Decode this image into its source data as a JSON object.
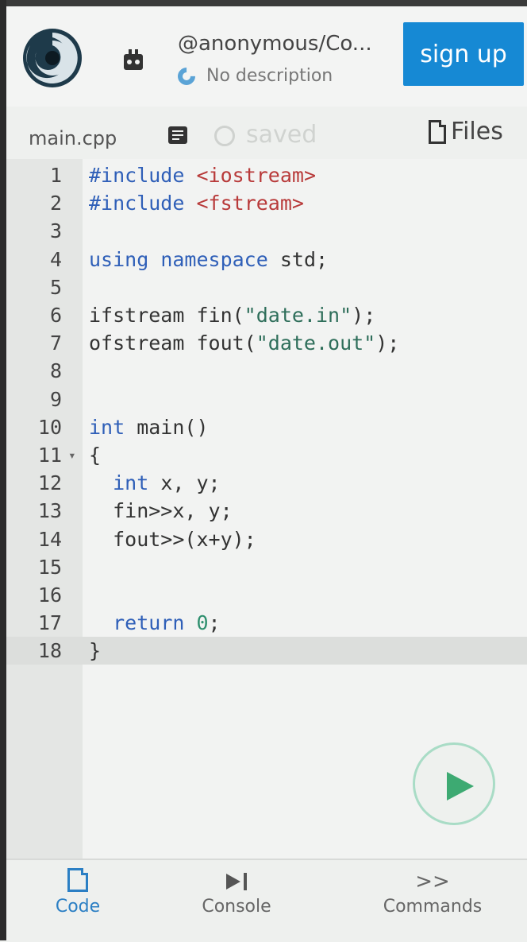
{
  "header": {
    "repl_user": "@anonymous/Co...",
    "repl_description": "No description",
    "signup_label": "sign up",
    "logo_icon": "replit-spiral-logo-icon",
    "avatar_icon": "bot-avatar-icon",
    "language_icon": "cpp-c-icon"
  },
  "filebar": {
    "filename": "main.cpp",
    "saved_label": "saved",
    "files_label": "Files",
    "doc_icon": "document-icon",
    "history_icon": "history-icon",
    "files_icon": "file-icon"
  },
  "editor": {
    "lines": [
      {
        "n": "1",
        "tokens": [
          {
            "t": "#include",
            "c": "kw"
          },
          {
            "t": " "
          },
          {
            "t": "<iostream>",
            "c": "str"
          }
        ]
      },
      {
        "n": "2",
        "tokens": [
          {
            "t": "#include",
            "c": "kw"
          },
          {
            "t": " "
          },
          {
            "t": "<fstream>",
            "c": "str"
          }
        ]
      },
      {
        "n": "3",
        "tokens": []
      },
      {
        "n": "4",
        "tokens": [
          {
            "t": "using",
            "c": "kw"
          },
          {
            "t": " "
          },
          {
            "t": "namespace",
            "c": "kw"
          },
          {
            "t": " std;"
          }
        ]
      },
      {
        "n": "5",
        "tokens": []
      },
      {
        "n": "6",
        "tokens": [
          {
            "t": "ifstream fin("
          },
          {
            "t": "\"date.in\"",
            "c": "lit"
          },
          {
            "t": ");"
          }
        ]
      },
      {
        "n": "7",
        "tokens": [
          {
            "t": "ofstream fout("
          },
          {
            "t": "\"date.out\"",
            "c": "lit"
          },
          {
            "t": ");"
          }
        ]
      },
      {
        "n": "8",
        "tokens": []
      },
      {
        "n": "9",
        "tokens": []
      },
      {
        "n": "10",
        "tokens": [
          {
            "t": "int",
            "c": "kw"
          },
          {
            "t": " main()"
          }
        ]
      },
      {
        "n": "11",
        "fold": "▾",
        "tokens": [
          {
            "t": "{"
          }
        ]
      },
      {
        "n": "12",
        "tokens": [
          {
            "t": "  "
          },
          {
            "t": "int",
            "c": "kw"
          },
          {
            "t": " x, y;"
          }
        ]
      },
      {
        "n": "13",
        "tokens": [
          {
            "t": "  fin>>x, y;"
          }
        ]
      },
      {
        "n": "14",
        "tokens": [
          {
            "t": "  fout>>(x+y);"
          }
        ]
      },
      {
        "n": "15",
        "tokens": []
      },
      {
        "n": "16",
        "tokens": []
      },
      {
        "n": "17",
        "tokens": [
          {
            "t": "  "
          },
          {
            "t": "return",
            "c": "kw"
          },
          {
            "t": " "
          },
          {
            "t": "0",
            "c": "num"
          },
          {
            "t": ";"
          }
        ]
      },
      {
        "n": "18",
        "active": true,
        "tokens": [
          {
            "t": "}"
          }
        ]
      }
    ],
    "run_icon": "play-icon"
  },
  "tabs": {
    "code": {
      "label": "Code",
      "icon": "code-file-icon"
    },
    "console": {
      "label": "Console",
      "icon": "console-icon"
    },
    "commands": {
      "label": "Commands",
      "icon": "chevrons-right-icon",
      "glyph": ">>"
    }
  }
}
